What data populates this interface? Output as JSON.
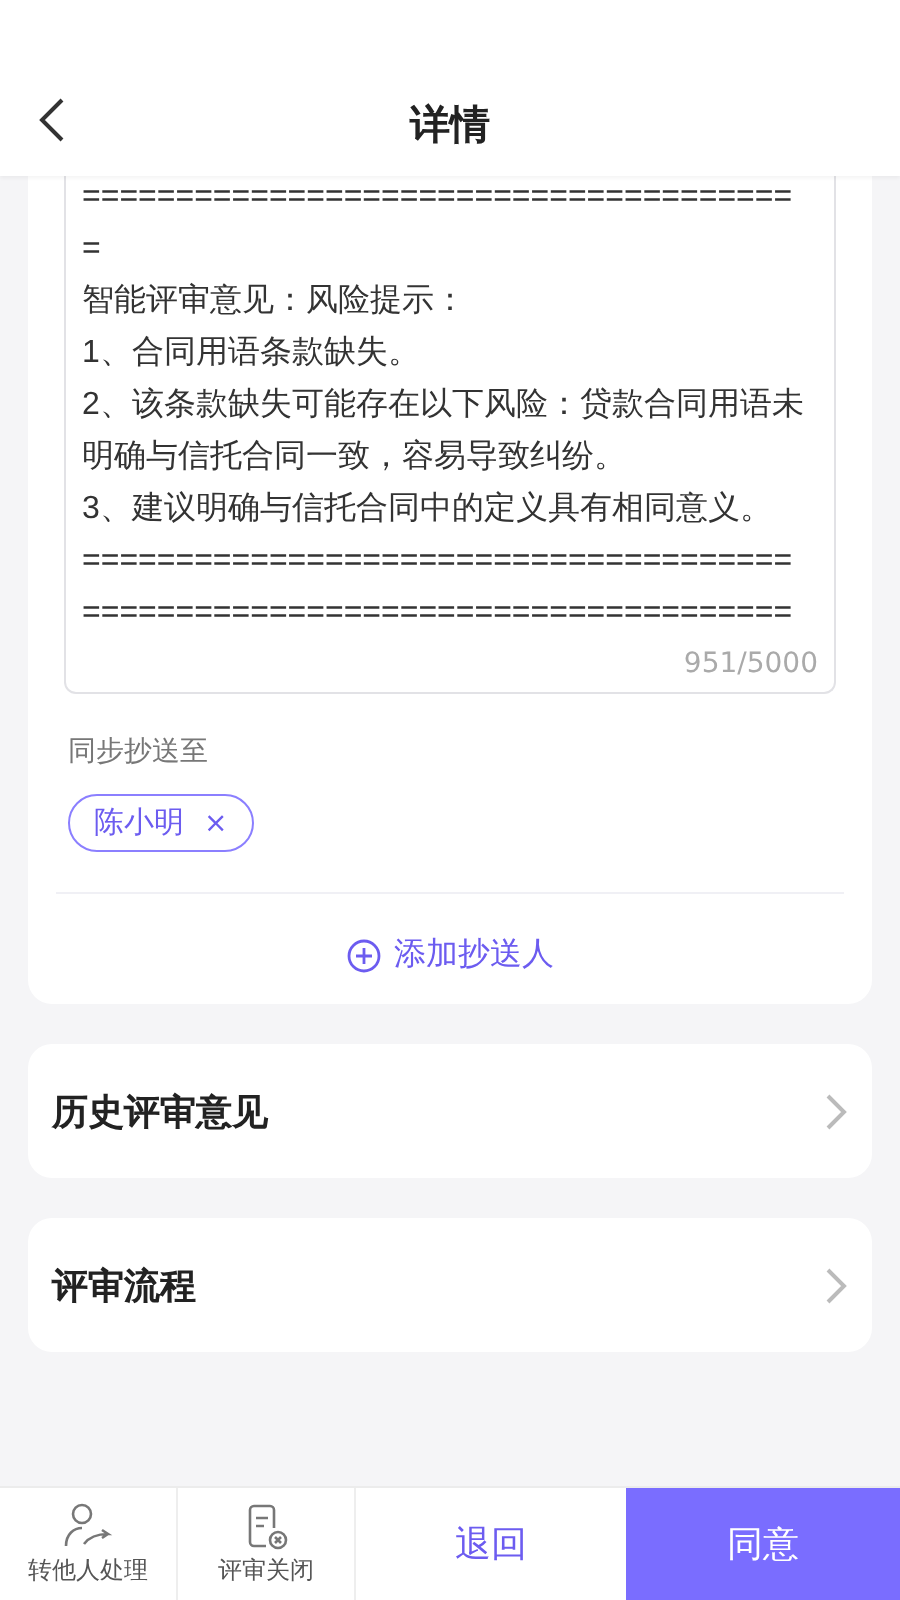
{
  "header": {
    "title": "详情"
  },
  "opinion": {
    "value": "=======================================\n智能评审意见：风险提示：\n1、合同用语条款缺失。\n2、该条款缺失可能存在以下风险：贷款合同用语未明确与信托合同一致，容易导致纠纷。\n3、建议明确与信托合同中的定义具有相同意义。\n======================================\n======================================",
    "count": "951/5000"
  },
  "cc": {
    "label": "同步抄送至",
    "recipients": [
      {
        "name": "陈小明",
        "remove": "×"
      }
    ],
    "add_label": "添加抄送人"
  },
  "sections": [
    {
      "title": "历史评审意见"
    },
    {
      "title": "评审流程"
    }
  ],
  "actions": [
    {
      "kind": "transfer",
      "label": "转他人处理"
    },
    {
      "kind": "close",
      "label": "评审关闭"
    },
    {
      "kind": "plain",
      "label": "退回"
    },
    {
      "kind": "primary",
      "label": "同意"
    }
  ]
}
